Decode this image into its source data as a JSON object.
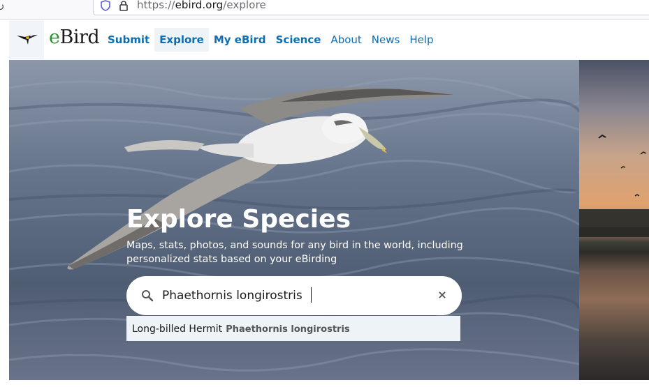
{
  "browser": {
    "url_scheme": "https://",
    "url_host": "ebird.org",
    "url_path": "/explore",
    "icons": [
      "reload-icon",
      "shield-icon",
      "lock-icon"
    ]
  },
  "header": {
    "logo_e": "e",
    "logo_rest": "Bird",
    "nav": [
      {
        "label": "Submit"
      },
      {
        "label": "Explore"
      },
      {
        "label": "My eBird"
      },
      {
        "label": "Science"
      },
      {
        "label": "About"
      },
      {
        "label": "News"
      },
      {
        "label": "Help"
      }
    ],
    "active_item": "Explore",
    "colors": {
      "link": "#0a6fb3",
      "active_bg": "#eef3f8",
      "logo_green": "#2f8f2f"
    }
  },
  "hero": {
    "title": "Explore Species",
    "subtitle": "Maps, stats, photos, and sounds for any bird in the world, including personalized stats based on your eBirding"
  },
  "search": {
    "value": "Phaethornis longirostris",
    "icons": [
      "search-icon",
      "clear-icon"
    ],
    "clear_glyph": "×",
    "suggestion": {
      "common_name": "Long-billed Hermit",
      "scientific_name": "Phaethornis longirostris"
    }
  }
}
